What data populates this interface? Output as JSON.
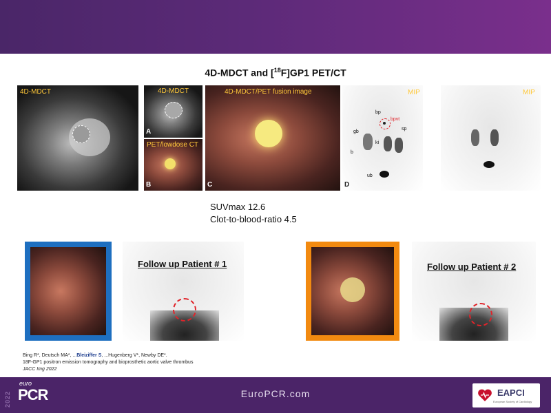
{
  "header": {
    "title_main": "4D-MDCT and [",
    "title_sup": "18",
    "title_end": "F]GP1 PET/CT"
  },
  "panels": {
    "main_ct_label": "4D-MDCT",
    "a_label": "4D-MDCT",
    "a_letter": "A",
    "b_label": "PET/lowdose CT",
    "b_letter": "B",
    "c_label": "4D-MDCT/PET fusion image",
    "c_letter": "C",
    "d_letter": "D",
    "mip1_label": "MIP",
    "mip2_label": "MIP",
    "organ_labels": [
      "bp",
      "bpvt",
      "gb",
      "sp",
      "ki",
      "ki",
      "b",
      "ub"
    ]
  },
  "stats": {
    "suv": "SUVmax 12.6",
    "ratio": "Clot-to-blood-ratio 4.5"
  },
  "followup": {
    "patient1": "Follow up Patient # 1",
    "patient2": "Follow up Patient # 2"
  },
  "reference": {
    "line1_a": "Bing R*, Deutsch MA*, ...",
    "line1_author": "Bleiziffer S",
    "line1_b": ", ...Hugenberg V*, Newby DE*.",
    "line2": "18F-GP1 positron emission tomography and bioprosthetic aortic valve thrombus",
    "line3": "JACC Img 2022"
  },
  "footer": {
    "year": "2022",
    "euro": "euro",
    "pcr": "PCR",
    "site": "EuroPCR.com",
    "eapci": "EAPCI",
    "eapci_sub": "European Society of Cardiology"
  },
  "colors": {
    "brand_purple": "#4b2468",
    "label_yellow": "#ffc83a",
    "marker_red": "#e0242a",
    "frame_blue": "#1e6fc0",
    "frame_orange": "#f28a10"
  }
}
